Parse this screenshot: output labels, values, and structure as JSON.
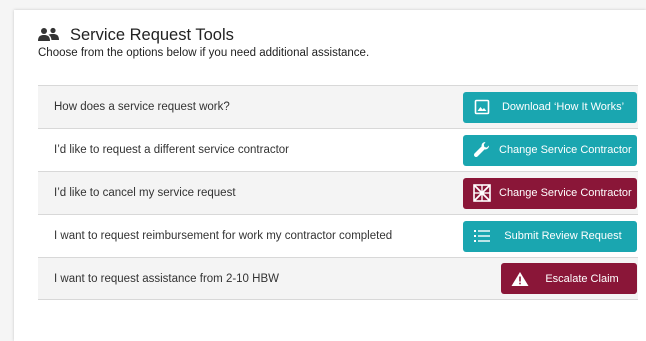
{
  "header": {
    "icon": "users-icon",
    "title": "Service Request Tools",
    "subtitle": "Choose from the options below if you need additional assistance."
  },
  "rows": [
    {
      "question": "How does a service request work?",
      "button_label": "Download ‘How It Works’",
      "icon": "image-icon",
      "color": "#1aa6b0"
    },
    {
      "question": "I’d like to request a different service contractor",
      "button_label": "Change Service Contractor",
      "icon": "wrench-icon",
      "color": "#1aa6b0"
    },
    {
      "question": "I’d like to cancel my service request",
      "button_label": "Change Service Contractor",
      "icon": "cancel-grid-icon",
      "color": "#8a1638"
    },
    {
      "question": "I want to request reimbursement for work my contractor completed",
      "button_label": "Submit Review Request",
      "icon": "list-icon",
      "color": "#1aa6b0"
    },
    {
      "question": "I want to request assistance from 2-10 HBW",
      "button_label": "Escalate Claim",
      "icon": "warning-icon",
      "color": "#8a1638"
    }
  ]
}
